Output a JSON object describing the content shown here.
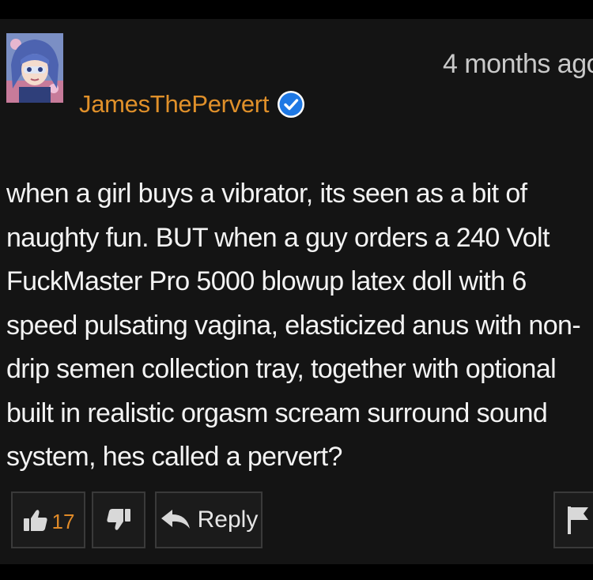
{
  "comment": {
    "username": "JamesThePervert",
    "verified": true,
    "timestamp": "4 months ago",
    "text": "when a girl buys a vibrator, its seen as a bit of\nnaughty fun. BUT when a guy orders a 240 Volt\nFuckMaster Pro 5000 blowup latex doll with 6\nspeed pulsating vagina, elasticized anus with non-\ndrip semen collection tray, together with optional\nbuilt in realistic orgasm scream surround sound\nsystem, hes called a pervert?"
  },
  "actions": {
    "like_count": "17",
    "reply_label": "Reply"
  },
  "icons": {
    "verified": "verified-check-icon",
    "like": "thumbs-up-icon",
    "dislike": "thumbs-down-icon",
    "reply": "reply-arrow-icon",
    "flag": "flag-icon"
  },
  "colors": {
    "username": "#e0902a",
    "like_count": "#e08a28",
    "verified_badge": "#1e78e4",
    "background": "#141414"
  }
}
